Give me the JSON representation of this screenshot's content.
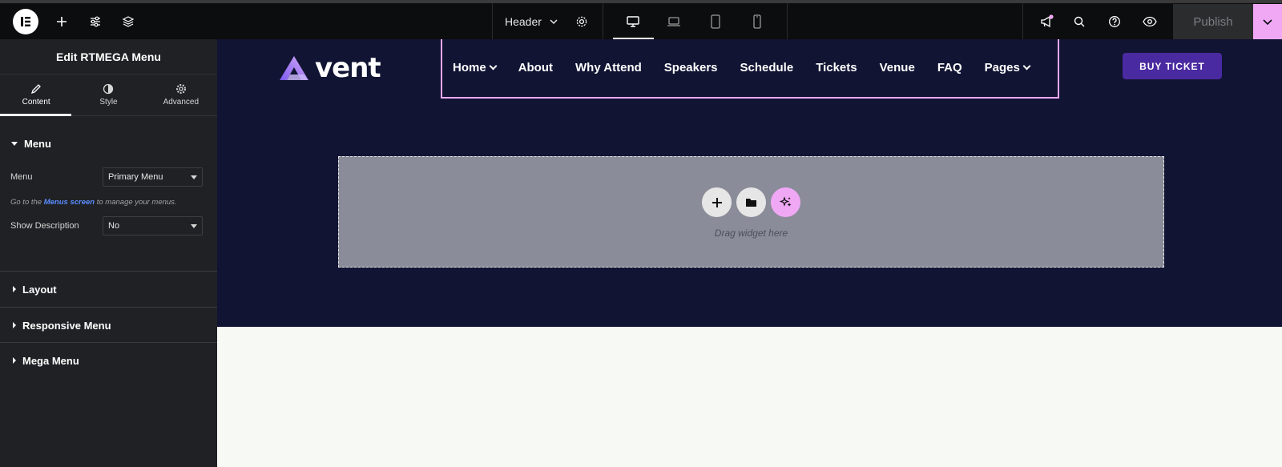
{
  "topbar": {
    "document_title": "Header",
    "publish_label": "Publish"
  },
  "panel": {
    "title": "Edit RTMEGA Menu",
    "tabs": [
      {
        "label": "Content",
        "icon": "pencil-icon"
      },
      {
        "label": "Style",
        "icon": "half-circle-icon"
      },
      {
        "label": "Advanced",
        "icon": "gear-icon"
      }
    ],
    "menu_section": {
      "title": "Menu",
      "menu_label": "Menu",
      "menu_value": "Primary Menu",
      "hint_prefix": "Go to the",
      "hint_link": "Menus screen",
      "hint_suffix": "to manage your menus.",
      "show_description_label": "Show Description",
      "show_description_value": "No"
    },
    "sections": [
      "Layout",
      "Responsive Menu",
      "Mega Menu"
    ]
  },
  "site": {
    "logo_text": "vent",
    "nav": [
      "Home",
      "About",
      "Why Attend",
      "Speakers",
      "Schedule",
      "Tickets",
      "Venue",
      "FAQ",
      "Pages"
    ],
    "buy_button": "BUY TICKET"
  },
  "drop_zone": {
    "text": "Drag widget here"
  },
  "colors": {
    "header_bg": "#111433",
    "accent_pink": "#f0a8f5",
    "buy_button": "#4a2aa0",
    "panel_bg": "#1f2124"
  }
}
